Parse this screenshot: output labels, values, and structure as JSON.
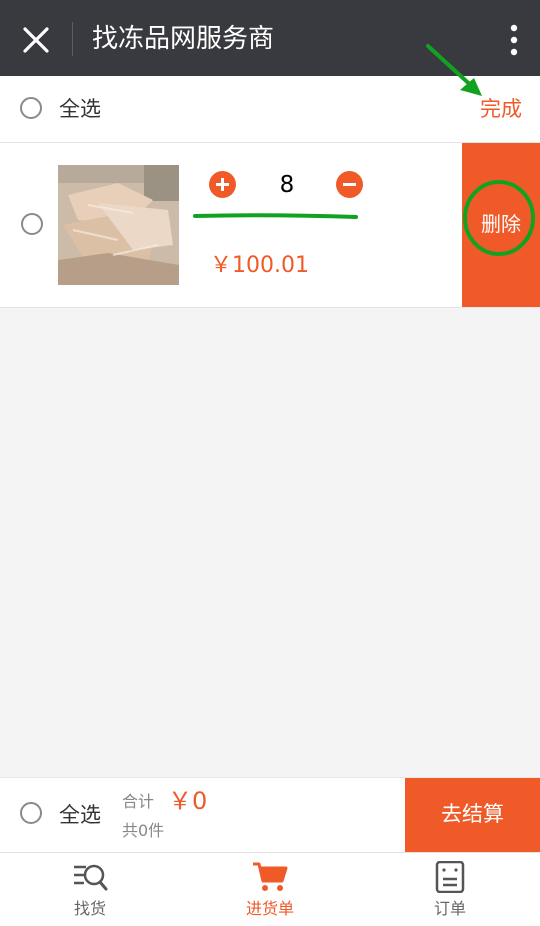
{
  "titlebar": {
    "title": "找冻品网服务商"
  },
  "select_bar": {
    "select_all_label": "全选",
    "done_label": "完成"
  },
  "cart_item": {
    "quantity": "8",
    "price": "￥100.01",
    "delete_label": "删除"
  },
  "checkout": {
    "select_all_label": "全选",
    "total_label": "合计",
    "total_value": "￥0",
    "count_text": "共0件",
    "checkout_label": "去结算"
  },
  "tabs": [
    {
      "label": "找货",
      "icon": "search-list-icon",
      "active": false
    },
    {
      "label": "进货单",
      "icon": "cart-icon",
      "active": true
    },
    {
      "label": "订单",
      "icon": "order-icon",
      "active": false
    }
  ],
  "colors": {
    "accent": "#f05a28",
    "titlebar": "#393a3f",
    "annotation": "#11a320"
  }
}
